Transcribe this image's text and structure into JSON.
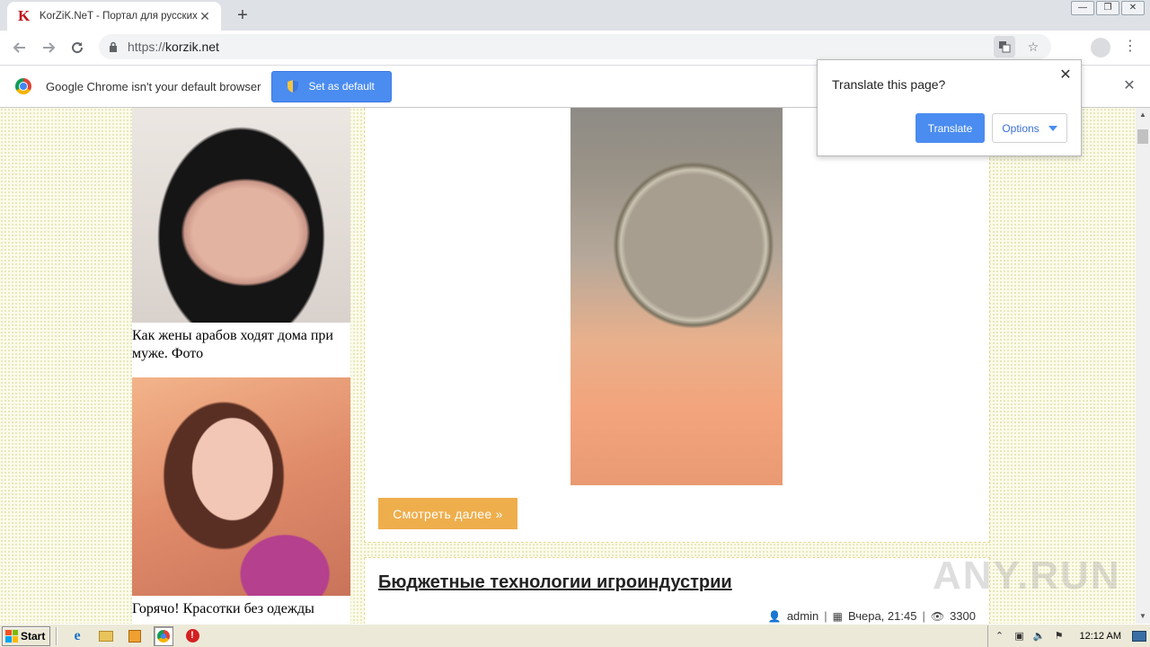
{
  "browser": {
    "tab_title": "KorZiK.NeT - Портал для русских!",
    "tab_favicon_letter": "K",
    "url_protocol": "https://",
    "url_host": "korzik.net"
  },
  "infobar": {
    "message": "Google Chrome isn't your default browser",
    "button_label": "Set as default"
  },
  "translate_bubble": {
    "title": "Translate this page?",
    "translate_label": "Translate",
    "options_label": "Options"
  },
  "sidebar": {
    "cards": [
      {
        "caption": "Как жены арабов ходят дома при муже. Фото"
      },
      {
        "caption": "Горячо! Красотки без одежды"
      }
    ]
  },
  "posts": {
    "first": {
      "more_label": "Смотреть далее »"
    },
    "second": {
      "title": "Бюджетные технологии игроиндустрии",
      "author": "admin",
      "date": "Вчера, 21:45",
      "views": "3300"
    }
  },
  "watermark": "ANY.RUN",
  "taskbar": {
    "start_label": "Start",
    "clock": "12:12 AM"
  },
  "colors": {
    "accent_blue": "#4a8cf0",
    "more_button": "#efae4c",
    "page_bg": "#fbfbe9"
  }
}
